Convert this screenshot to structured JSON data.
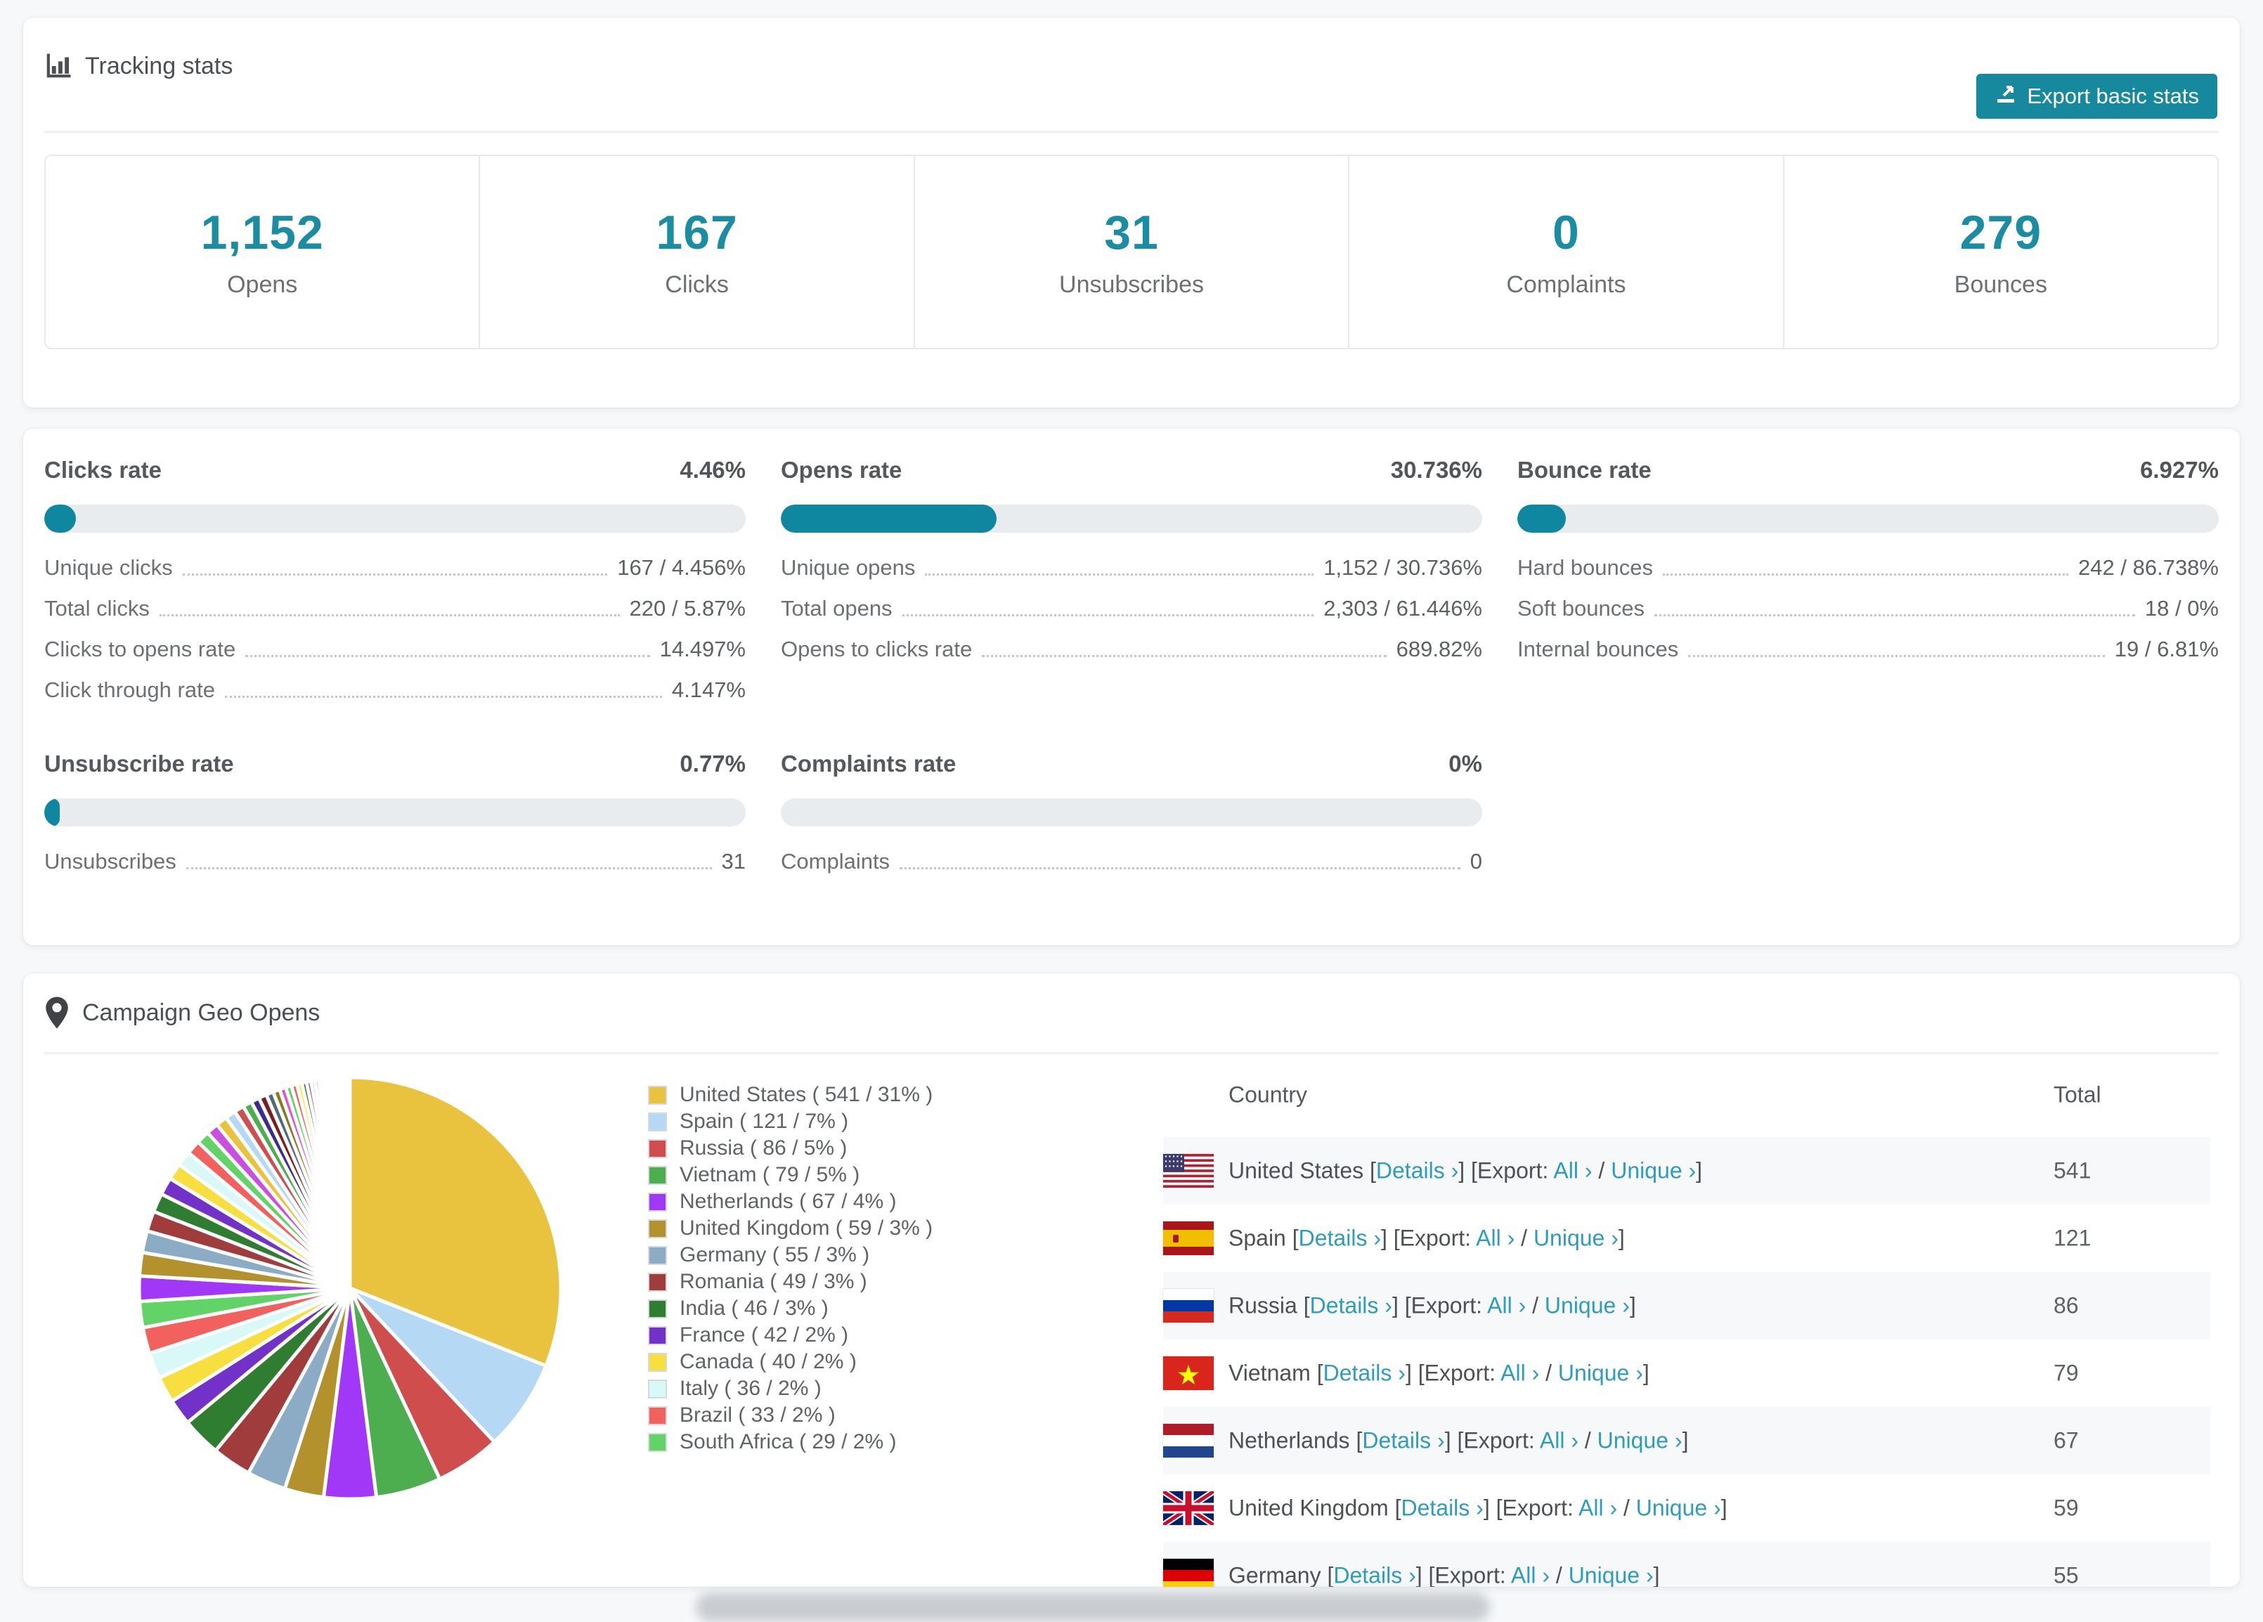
{
  "accent": "#17899e",
  "tracking_card": {
    "title": "Tracking stats",
    "export_button": "Export basic stats",
    "stats": [
      {
        "value": "1,152",
        "label": "Opens"
      },
      {
        "value": "167",
        "label": "Clicks"
      },
      {
        "value": "31",
        "label": "Unsubscribes"
      },
      {
        "value": "0",
        "label": "Complaints"
      },
      {
        "value": "279",
        "label": "Bounces"
      }
    ]
  },
  "rates_card": {
    "blocks": [
      {
        "title": "Clicks rate",
        "value": "4.46%",
        "bar_pct": 4.46,
        "rows": [
          {
            "label": "Unique clicks",
            "value": "167 / 4.456%"
          },
          {
            "label": "Total clicks",
            "value": "220 / 5.87%"
          },
          {
            "label": "Clicks to opens rate",
            "value": "14.497%"
          },
          {
            "label": "Click through rate",
            "value": "4.147%"
          }
        ]
      },
      {
        "title": "Opens rate",
        "value": "30.736%",
        "bar_pct": 30.736,
        "rows": [
          {
            "label": "Unique opens",
            "value": "1,152 / 30.736%"
          },
          {
            "label": "Total opens",
            "value": "2,303 / 61.446%"
          },
          {
            "label": "Opens to clicks rate",
            "value": "689.82%"
          }
        ]
      },
      {
        "title": "Bounce rate",
        "value": "6.927%",
        "bar_pct": 6.927,
        "rows": [
          {
            "label": "Hard bounces",
            "value": "242 / 86.738%"
          },
          {
            "label": "Soft bounces",
            "value": "18 / 0%"
          },
          {
            "label": "Internal bounces",
            "value": "19 / 6.81%"
          }
        ]
      },
      {
        "title": "Unsubscribe rate",
        "value": "0.77%",
        "bar_pct": 0.77,
        "rows": [
          {
            "label": "Unsubscribes",
            "value": "31"
          }
        ]
      },
      {
        "title": "Complaints rate",
        "value": "0%",
        "bar_pct": 0,
        "rows": [
          {
            "label": "Complaints",
            "value": "0"
          }
        ]
      }
    ]
  },
  "geo_card": {
    "title": "Campaign Geo Opens",
    "chart_data": {
      "type": "pie",
      "title": "Campaign Geo Opens",
      "legend_position": "right",
      "start_angle_deg": 0,
      "direction": "clockwise",
      "points": [
        {
          "label": "United States",
          "count": 541,
          "pct": 31,
          "color": "#e9c23e",
          "flag": "us"
        },
        {
          "label": "Spain",
          "count": 121,
          "pct": 7,
          "color": "#b5d9f5",
          "flag": "es"
        },
        {
          "label": "Russia",
          "count": 86,
          "pct": 5,
          "color": "#cf4d4d",
          "flag": "ru"
        },
        {
          "label": "Vietnam",
          "count": 79,
          "pct": 5,
          "color": "#4cae4f",
          "flag": "vn"
        },
        {
          "label": "Netherlands",
          "count": 67,
          "pct": 4,
          "color": "#a238f7",
          "flag": "nl"
        },
        {
          "label": "United Kingdom",
          "count": 59,
          "pct": 3,
          "color": "#b3912d",
          "flag": "gb"
        },
        {
          "label": "Germany",
          "count": 55,
          "pct": 3,
          "color": "#8cabc4",
          "flag": "de"
        },
        {
          "label": "Romania",
          "count": 49,
          "pct": 3,
          "color": "#a03c3c"
        },
        {
          "label": "India",
          "count": 46,
          "pct": 3,
          "color": "#2f7d31"
        },
        {
          "label": "France",
          "count": 42,
          "pct": 2,
          "color": "#7231c9"
        },
        {
          "label": "Canada",
          "count": 40,
          "pct": 2,
          "color": "#f6df3e"
        },
        {
          "label": "Italy",
          "count": 36,
          "pct": 2,
          "color": "#d9f8f8"
        },
        {
          "label": "Brazil",
          "count": 33,
          "pct": 2,
          "color": "#f2615e"
        },
        {
          "label": "South Africa",
          "count": 29,
          "pct": 2,
          "color": "#62d366"
        }
      ],
      "others_visual_slices": {
        "total_pct": 26,
        "count": 40,
        "decay": 0.93,
        "colors": [
          "#a238f7",
          "#b3912d",
          "#8cabc4",
          "#a03c3c",
          "#2f7d31",
          "#7231c9",
          "#f6df3e",
          "#d9f8f8",
          "#f2615e",
          "#62d366",
          "#c94fe0",
          "#e9c23e",
          "#b5d9f5",
          "#cf4d4d",
          "#4cae4f",
          "#3c2c8f",
          "#7a1f1f",
          "#516b7a",
          "#8a7a1f",
          "#e44fd0",
          "#62d366",
          "#f2615e",
          "#fce94f",
          "#2f7d31",
          "#a03c3c",
          "#b5d9f5",
          "#cf4d4d",
          "#4cae4f",
          "#a238f7",
          "#b3912d",
          "#d9f8f8",
          "#7231c9",
          "#e9c23e",
          "#8cabc4",
          "#f2615e",
          "#62d366",
          "#c94fe0",
          "#cf4d4d",
          "#4cae4f",
          "#a238f7"
        ]
      }
    },
    "legend_format": "{label} ( {count} / {pct}% )",
    "table": {
      "headers": {
        "country": "Country",
        "total": "Total"
      },
      "links": {
        "details": "Details ›",
        "export_prefix": "Export:",
        "all": "All ›",
        "unique": "Unique ›"
      },
      "rows": [
        {
          "country": "United States",
          "flag": "us",
          "total": "541"
        },
        {
          "country": "Spain",
          "flag": "es",
          "total": "121"
        },
        {
          "country": "Russia",
          "flag": "ru",
          "total": "86"
        },
        {
          "country": "Vietnam",
          "flag": "vn",
          "total": "79"
        },
        {
          "country": "Netherlands",
          "flag": "nl",
          "total": "67"
        },
        {
          "country": "United Kingdom",
          "flag": "gb",
          "total": "59"
        },
        {
          "country": "Germany",
          "flag": "de",
          "total": "55"
        }
      ]
    }
  }
}
